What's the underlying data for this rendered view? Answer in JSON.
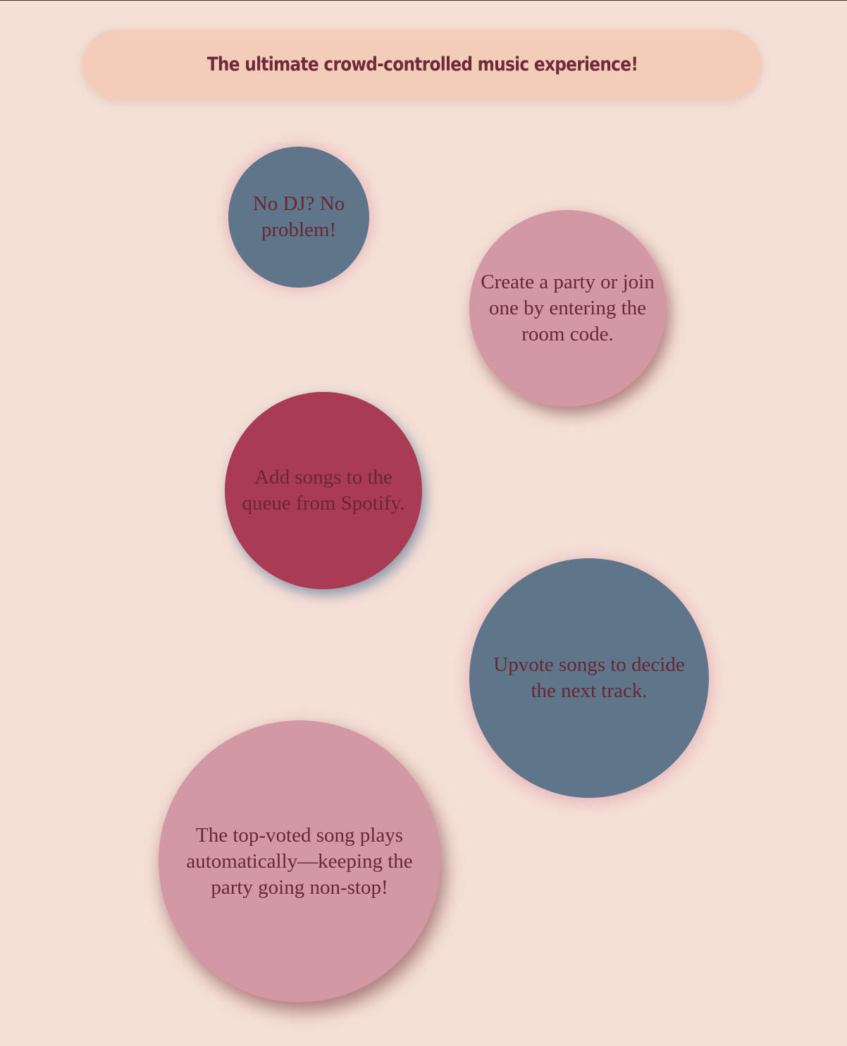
{
  "header": {
    "tagline": "The ultimate crowd-controlled music experience!"
  },
  "features": [
    {
      "text": "No DJ? No problem!"
    },
    {
      "text": "Create a party or join one by entering the room code."
    },
    {
      "text": "Add songs to the queue from Spotify."
    },
    {
      "text": "Upvote songs to decide the next track."
    },
    {
      "text": "The top-voted song plays automatically—keeping the party going non-stop!"
    }
  ],
  "colors": {
    "background": "#f5e0d7",
    "banner": "#f3cdb9",
    "text": "#6b2633",
    "slate": "#5e758a",
    "pink": "#d298a3",
    "crimson": "#a93c54"
  }
}
